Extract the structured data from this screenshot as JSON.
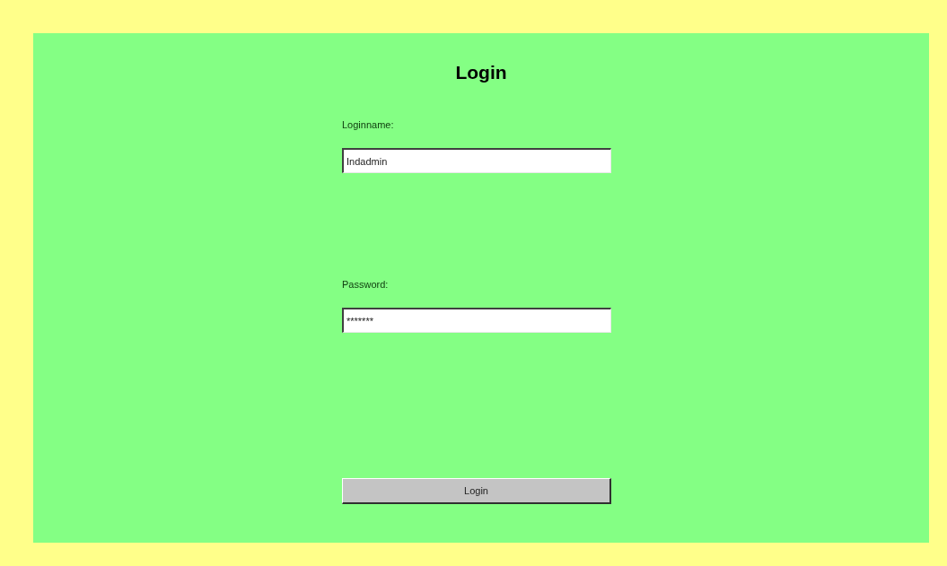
{
  "title": "Login",
  "fields": [
    {
      "label": "Loginname:",
      "value": "Indadmin"
    },
    {
      "label": "Password:",
      "value": "*******"
    }
  ],
  "button": "Login"
}
